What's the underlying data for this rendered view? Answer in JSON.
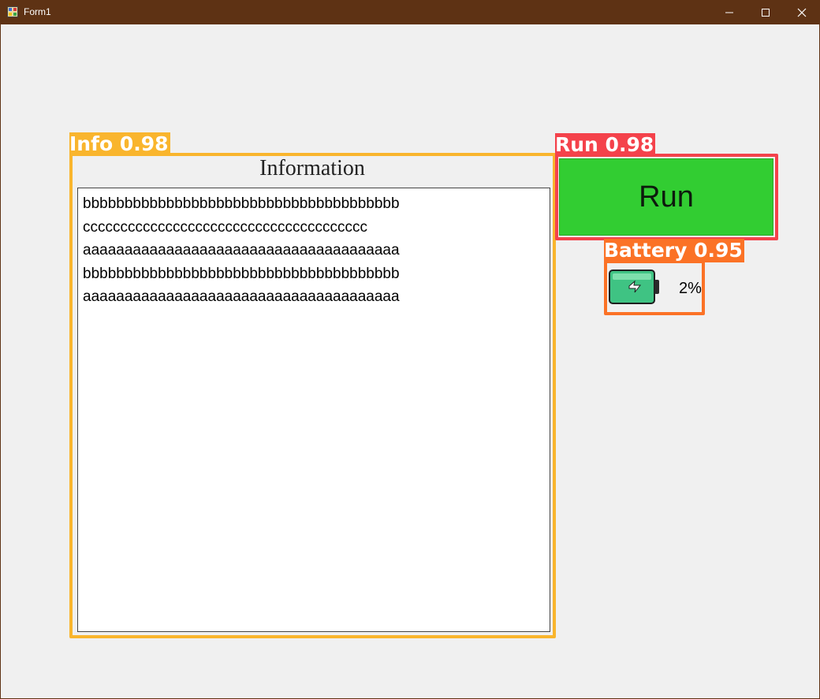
{
  "window": {
    "title": "Form1",
    "minimize_icon": "minimize-icon",
    "maximize_icon": "maximize-icon",
    "close_icon": "close-icon"
  },
  "info": {
    "caption": "Information",
    "lines": [
      "bbbbbbbbbbbbbbbbbbbbbbbbbbbbbbbbbbbbbb",
      "cccccccccccccccccccccccccccccccccccccc",
      "aaaaaaaaaaaaaaaaaaaaaaaaaaaaaaaaaaaaaa",
      "bbbbbbbbbbbbbbbbbbbbbbbbbbbbbbbbbbbbbb",
      "aaaaaaaaaaaaaaaaaaaaaaaaaaaaaaaaaaaaaa"
    ]
  },
  "run_button": {
    "label": "Run",
    "color": "#32cd32"
  },
  "battery": {
    "percent_text": "2%",
    "icon": "battery-charging-icon"
  },
  "detections": [
    {
      "label": "Info 0.98",
      "color": "#f9b52d"
    },
    {
      "label": "Run 0.98",
      "color": "#f4424b"
    },
    {
      "label": "Battery 0.95",
      "color": "#fb7226"
    }
  ]
}
